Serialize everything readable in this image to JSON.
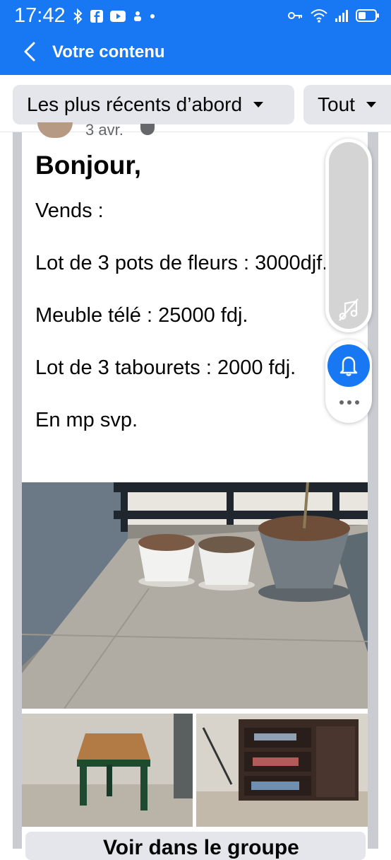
{
  "status_bar": {
    "time": "17:42"
  },
  "app_bar": {
    "title": "Votre contenu"
  },
  "filters": {
    "sort_label": "Les plus récents d’abord",
    "type_label": "Tout"
  },
  "post": {
    "date_partial": "3 avr.",
    "headline": "Bonjour,",
    "paragraphs": [
      "Vends :",
      "Lot de 3 pots de fleurs : 3000djf.",
      "Meuble télé : 25000 fdj.",
      "Lot de 3 tabourets : 2000 fdj.",
      "En mp svp."
    ]
  },
  "bottom_button": {
    "label": "Voir dans le groupe"
  },
  "colors": {
    "brand": "#1877f2",
    "chip": "#e4e6eb",
    "text": "#050505",
    "secondary": "#65676b"
  },
  "icons": [
    "back-arrow-icon",
    "bluetooth-icon",
    "facebook-icon",
    "youtube-icon",
    "key-icon",
    "wifi-icon",
    "signal-icon",
    "battery-icon",
    "music-off-icon",
    "bell-icon",
    "more-icon"
  ]
}
